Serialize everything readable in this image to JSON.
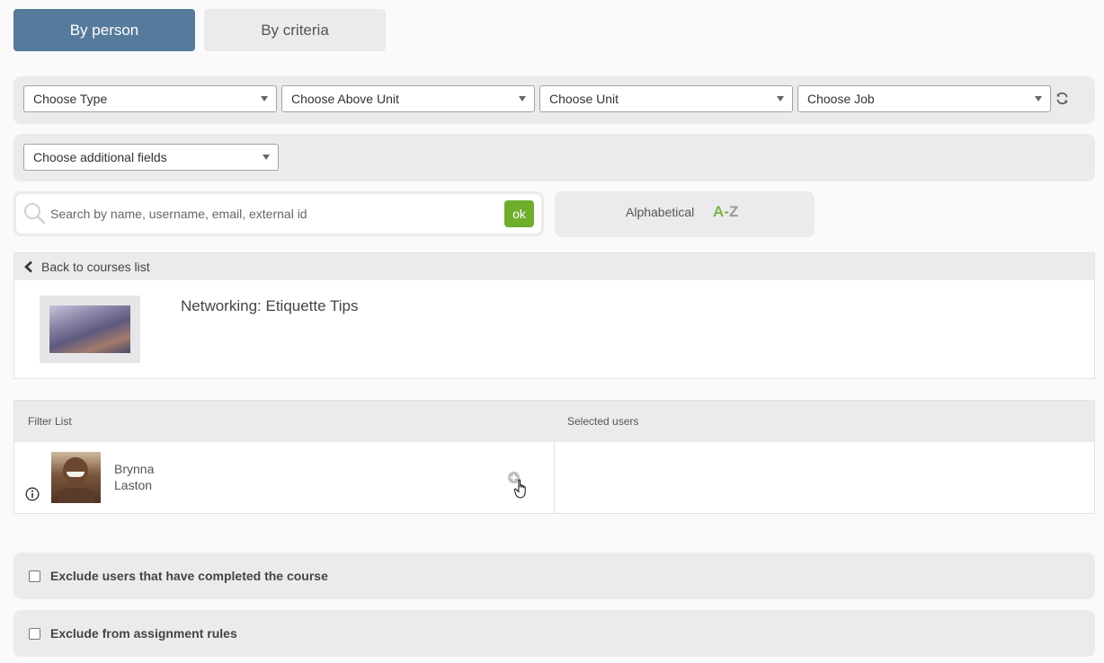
{
  "tabs": {
    "by_person": "By person",
    "by_criteria": "By criteria"
  },
  "filters": {
    "type": "Choose Type",
    "above_unit": "Choose Above Unit",
    "unit": "Choose Unit",
    "job": "Choose Job",
    "additional": "Choose additional fields"
  },
  "search": {
    "placeholder": "Search by name, username, email, external id",
    "ok": "ok"
  },
  "sort": {
    "label": "Alphabetical",
    "az_a": "A",
    "az_dash": "-",
    "az_z": "Z"
  },
  "course": {
    "back": "Back to courses list",
    "title": "Networking: Etiquette Tips"
  },
  "lists": {
    "filter_header": "Filter List",
    "selected_header": "Selected users",
    "users": [
      {
        "first": "Brynna",
        "last": "Laston"
      }
    ]
  },
  "options": {
    "exclude_completed": "Exclude users that have completed the course",
    "exclude_rules": "Exclude from assignment rules"
  },
  "colors": {
    "accent": "#567a9b",
    "ok": "#6eae2c",
    "az_green": "#7ab648",
    "az_gray": "#9a9a9a"
  }
}
